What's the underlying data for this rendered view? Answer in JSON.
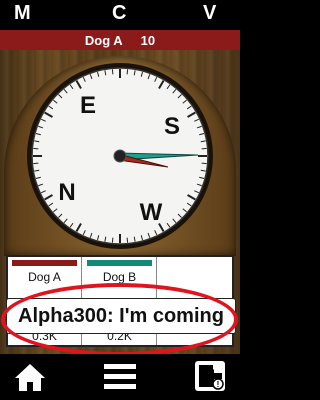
{
  "top_bar": {
    "left": "M",
    "center": "C",
    "right": "V"
  },
  "dog_bar": {
    "name": "Dog A",
    "value": "10"
  },
  "compass": {
    "letters": {
      "north": "N",
      "east": "E",
      "south": "S",
      "west": "W"
    }
  },
  "dogs": [
    {
      "name": "Dog A",
      "color": "#8b1a1a",
      "value": "0.3K"
    },
    {
      "name": "Dog B",
      "color": "#128a7a",
      "value": "0.2K"
    },
    {
      "name": "",
      "color": "",
      "value": ""
    }
  ],
  "toast": {
    "message": "Alpha300: I'm coming"
  },
  "bottom_nav": {
    "home_icon": "home-icon",
    "menu_icon": "menu-icon",
    "exit_icon": "exit-icon"
  },
  "colors": {
    "accent_red": "#8b1a1a",
    "highlight_ring": "#e0141e",
    "needle_teal": "#1f9e8e",
    "needle_red": "#a82a1e"
  }
}
